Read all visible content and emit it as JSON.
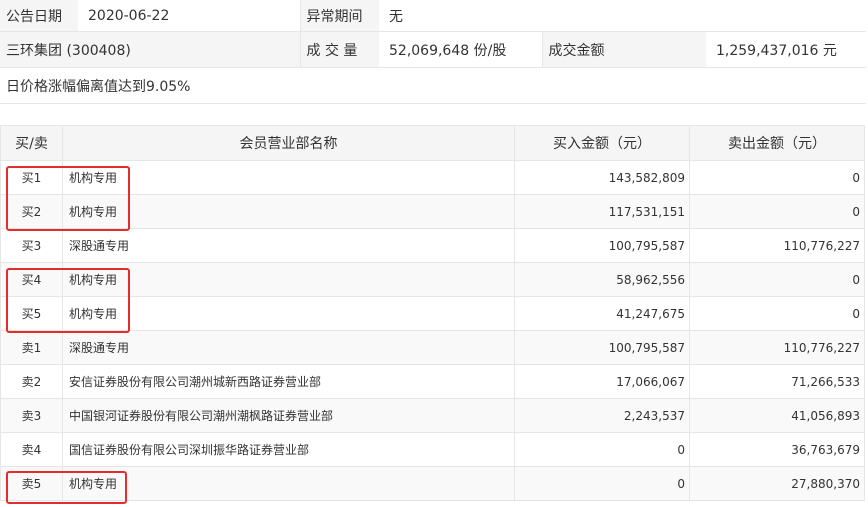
{
  "summary": {
    "date_label": "公告日期",
    "date_value": "2020-06-22",
    "period_label": "异常期间",
    "period_value": "无",
    "stock_name": "三环集团 (300408)",
    "volume_label": "成 交 量",
    "volume_value": "52,069,648 份/股",
    "amount_label": "成交金额",
    "amount_value": "1,259,437,016 元",
    "reason": "日价格涨幅偏离值达到9.05%"
  },
  "table": {
    "headers": [
      "买/卖",
      "会员营业部名称",
      "买入金额（元）",
      "卖出金额（元）"
    ],
    "rows": [
      {
        "side": "买1",
        "name": "机构专用",
        "buy": "143,582,809",
        "sell": "0"
      },
      {
        "side": "买2",
        "name": "机构专用",
        "buy": "117,531,151",
        "sell": "0"
      },
      {
        "side": "买3",
        "name": "深股通专用",
        "buy": "100,795,587",
        "sell": "110,776,227"
      },
      {
        "side": "买4",
        "name": "机构专用",
        "buy": "58,962,556",
        "sell": "0"
      },
      {
        "side": "买5",
        "name": "机构专用",
        "buy": "41,247,675",
        "sell": "0"
      },
      {
        "side": "卖1",
        "name": "深股通专用",
        "buy": "100,795,587",
        "sell": "110,776,227"
      },
      {
        "side": "卖2",
        "name": "安信证券股份有限公司潮州城新西路证券营业部",
        "buy": "17,066,067",
        "sell": "71,266,533"
      },
      {
        "side": "卖3",
        "name": "中国银河证券股份有限公司潮州潮枫路证券营业部",
        "buy": "2,243,537",
        "sell": "41,056,893"
      },
      {
        "side": "卖4",
        "name": "国信证券股份有限公司深圳振华路证券营业部",
        "buy": "0",
        "sell": "36,763,679"
      },
      {
        "side": "卖5",
        "name": "机构专用",
        "buy": "0",
        "sell": "27,880,370"
      }
    ]
  },
  "colors": {
    "highlight": "#e52c2c",
    "header_bg": "#f5f5f5",
    "border": "#e6e6e6"
  }
}
